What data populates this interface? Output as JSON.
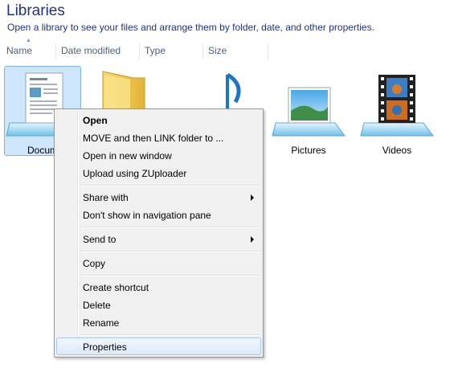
{
  "header": {
    "title": "Libraries",
    "subtitle": "Open a library to see your files and arrange them by folder, date, and other properties."
  },
  "columns": [
    "Name",
    "Date modified",
    "Type",
    "Size"
  ],
  "libraries": [
    {
      "label": "Docum",
      "icon": "documents-library-icon",
      "selected": true
    },
    {
      "label": "",
      "icon": "folder-icon"
    },
    {
      "label": "",
      "icon": "music-library-icon"
    },
    {
      "label": "Pictures",
      "icon": "pictures-library-icon"
    },
    {
      "label": "Videos",
      "icon": "videos-library-icon"
    }
  ],
  "context_menu": {
    "items": [
      "Open",
      "MOVE and then LINK folder to ...",
      "Open in new window",
      "Upload using ZUploader",
      "Share with",
      "Don't show in navigation pane",
      "Send to",
      "Copy",
      "Create shortcut",
      "Delete",
      "Rename",
      "Properties"
    ],
    "default_item": "Open",
    "highlighted_item": "Properties",
    "submenu_items": [
      "Share with",
      "Send to"
    ]
  },
  "colors": {
    "title": "#1e3287",
    "selection": "#cde6fb",
    "menu_background": "#f0f0f0"
  }
}
